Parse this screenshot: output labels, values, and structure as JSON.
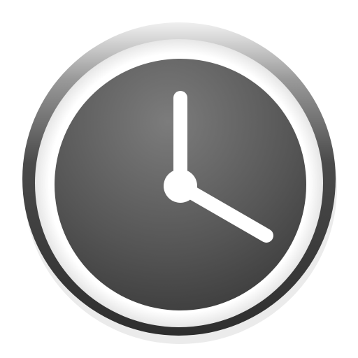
{
  "app_icon": {
    "icon": "clock-icon",
    "time_shown": {
      "hour": 4,
      "minute": 0
    },
    "colors": {
      "bezel_outer": "#3a3a3a",
      "bezel_highlight": "#e8e8e8",
      "ring": "#ffffff",
      "face_center": "#7a7a7a",
      "face_edge": "#3c3c3c",
      "hands": "#ffffff"
    }
  }
}
